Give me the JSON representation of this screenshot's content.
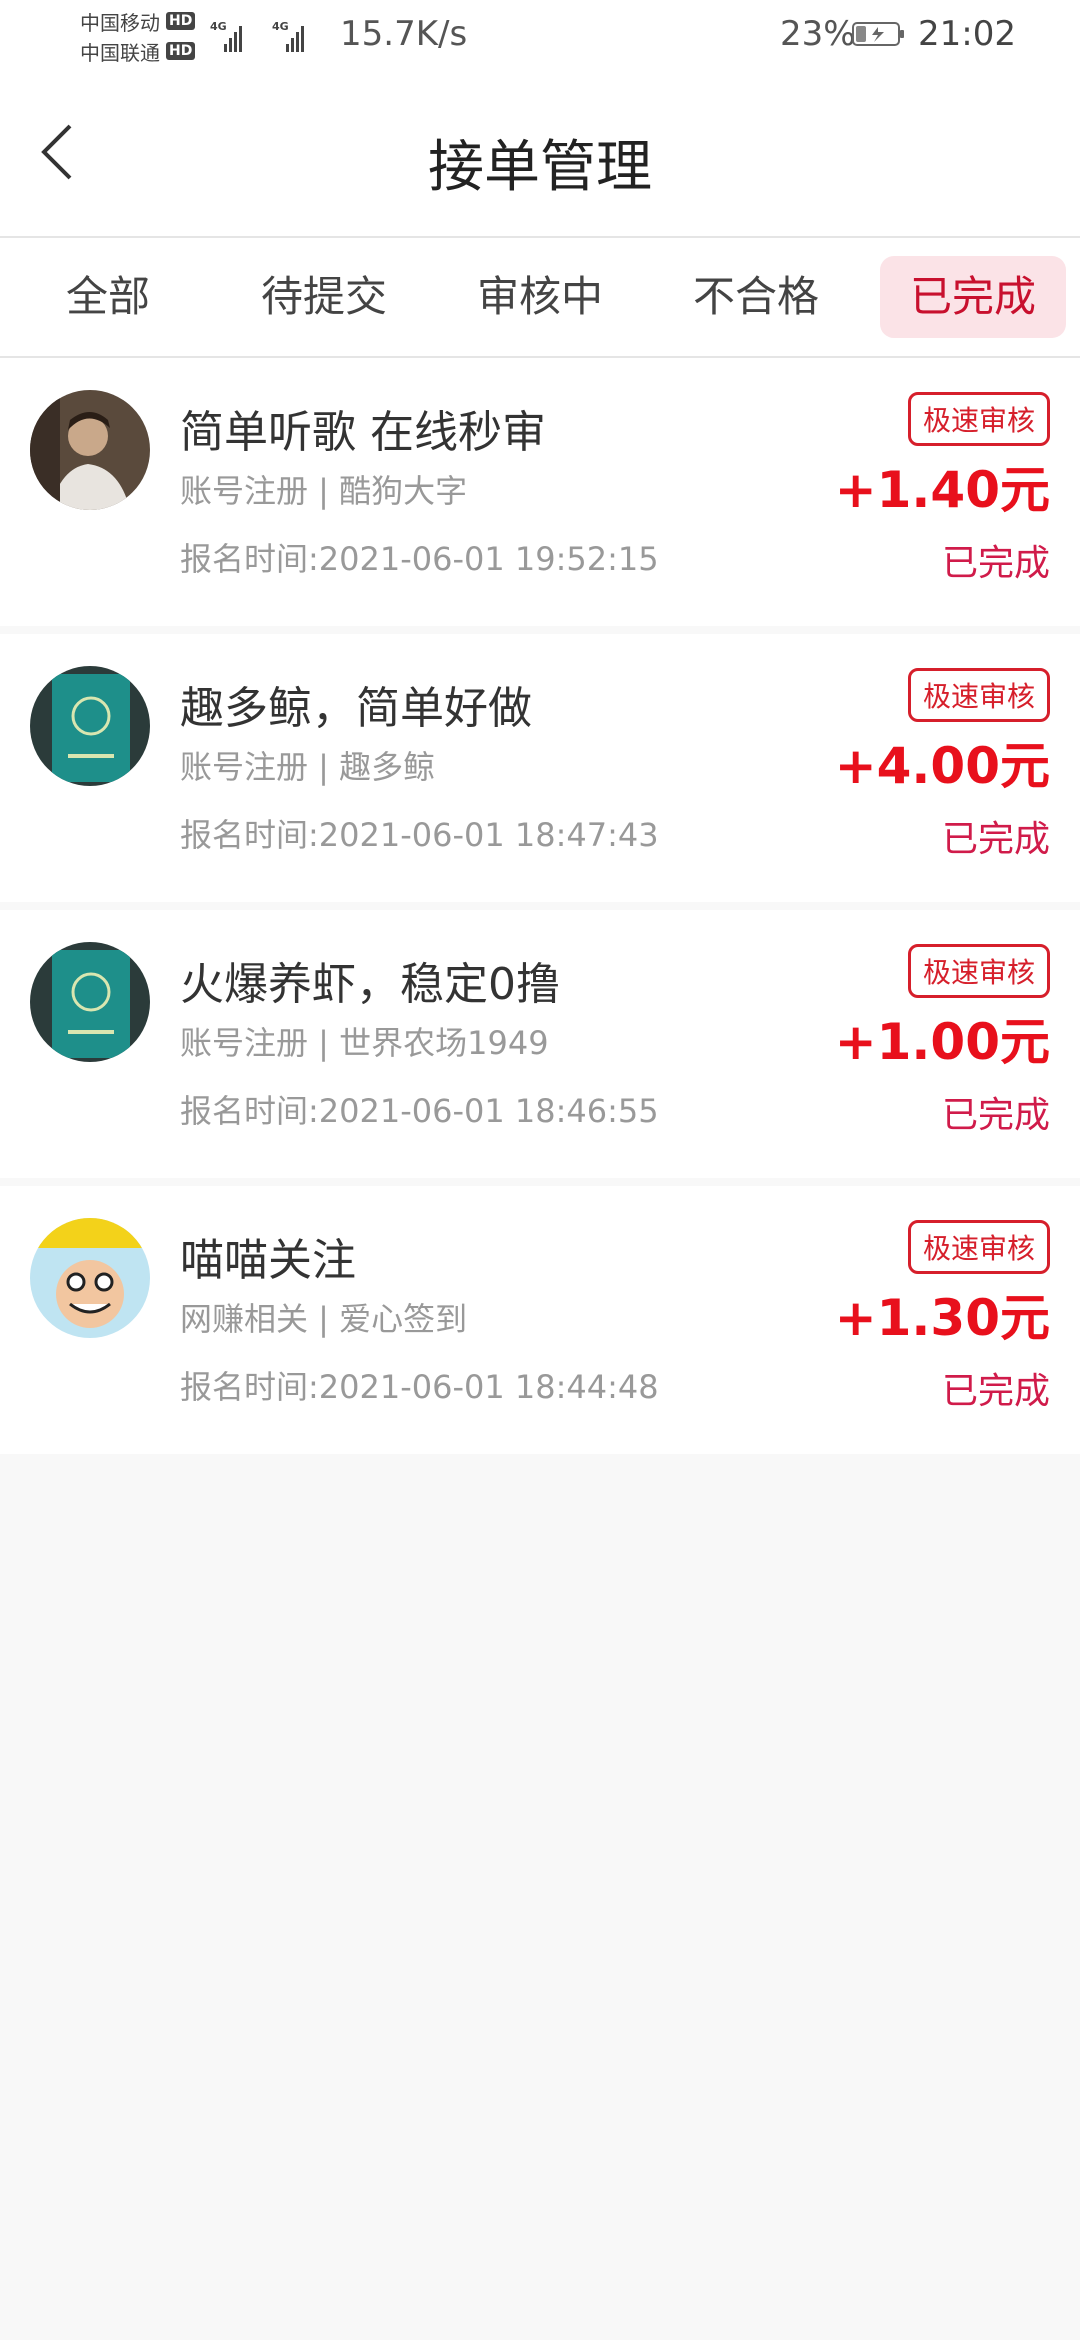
{
  "status_bar": {
    "carrier1": "中国移动",
    "carrier2": "中国联通",
    "hd": "HD",
    "net_type": "4G",
    "net_speed": "15.7K/s",
    "battery_percent": "23%",
    "time": "21:02"
  },
  "header": {
    "title": "接单管理",
    "back_icon": "chevron-left-icon"
  },
  "tabs": [
    {
      "label": "全部",
      "active": false
    },
    {
      "label": "待提交",
      "active": false
    },
    {
      "label": "审核中",
      "active": false
    },
    {
      "label": "不合格",
      "active": false
    },
    {
      "label": "已完成",
      "active": true
    }
  ],
  "orders": [
    {
      "title": "简单听歌 在线秒审",
      "category": "账号注册 | 酷狗大字",
      "time": "报名时间:2021-06-01 19:52:15",
      "badge": "极速审核",
      "amount": "+1.40元",
      "status": "已完成"
    },
    {
      "title": "趣多鲸，简单好做",
      "category": "账号注册 | 趣多鲸",
      "time": "报名时间:2021-06-01 18:47:43",
      "badge": "极速审核",
      "amount": "+4.00元",
      "status": "已完成"
    },
    {
      "title": "火爆养虾，稳定0撸",
      "category": "账号注册 | 世界农场1949",
      "time": "报名时间:2021-06-01 18:46:55",
      "badge": "极速审核",
      "amount": "+1.00元",
      "status": "已完成"
    },
    {
      "title": "喵喵关注",
      "category": "网赚相关 | 爱心签到",
      "time": "报名时间:2021-06-01 18:44:48",
      "badge": "极速审核",
      "amount": "+1.30元",
      "status": "已完成"
    }
  ],
  "colors": {
    "accent_red": "#e8101c",
    "tab_active_bg": "#fbe3e7",
    "status_text": "#d01b4a"
  }
}
